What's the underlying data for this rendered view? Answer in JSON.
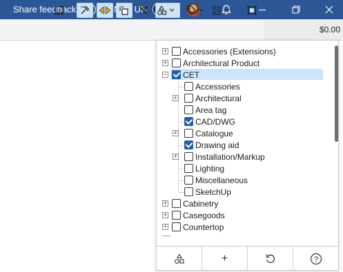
{
  "titlebar": {
    "share_feedback": "Share feedback",
    "new_ui_label": "New UI",
    "new_ui_enabled": true,
    "icons": [
      "help-icon",
      "avatar",
      "notification-icon",
      "minimize-icon",
      "restore-icon",
      "close-icon"
    ],
    "background": "#2b5797"
  },
  "toolbar": {
    "price": "$0.00",
    "tools": [
      "book-icon",
      "pin-tool-icon",
      "mirror-icon",
      "rotate-corner-icon",
      "measure-tool-icon",
      "shapes-filter-icon",
      "tag-icon",
      "list-icon",
      "crop-frame-icon"
    ]
  },
  "filter_panel": {
    "items": [
      {
        "label": "Accessories (Extensions)",
        "expandable": true,
        "checked": false,
        "level": 0
      },
      {
        "label": "Architectural Product",
        "expandable": true,
        "checked": false,
        "level": 0
      },
      {
        "label": "CET",
        "expandable": true,
        "expanded": true,
        "checked": true,
        "level": 0,
        "selected": true
      },
      {
        "label": "Accessories",
        "expandable": false,
        "checked": false,
        "level": 1
      },
      {
        "label": "Architectural",
        "expandable": true,
        "checked": false,
        "level": 1
      },
      {
        "label": "Area tag",
        "expandable": false,
        "checked": false,
        "level": 1
      },
      {
        "label": "CAD/DWG",
        "expandable": false,
        "checked": true,
        "level": 1
      },
      {
        "label": "Catalogue",
        "expandable": true,
        "checked": false,
        "level": 1
      },
      {
        "label": "Drawing aid",
        "expandable": false,
        "checked": true,
        "level": 1
      },
      {
        "label": "Installation/Markup",
        "expandable": true,
        "checked": false,
        "level": 1
      },
      {
        "label": "Lighting",
        "expandable": false,
        "checked": false,
        "level": 1
      },
      {
        "label": "Miscellaneous",
        "expandable": false,
        "checked": false,
        "level": 1
      },
      {
        "label": "SketchUp",
        "expandable": false,
        "checked": false,
        "level": 1
      },
      {
        "label": "Cabinetry",
        "expandable": true,
        "checked": false,
        "level": 0
      },
      {
        "label": "Casegoods",
        "expandable": true,
        "checked": false,
        "level": 0
      },
      {
        "label": "Countertop",
        "expandable": true,
        "checked": false,
        "level": 0
      }
    ],
    "bottom_buttons": [
      {
        "icon": "shapes-icon",
        "symbol": "⌂"
      },
      {
        "icon": "add-icon",
        "symbol": "+"
      },
      {
        "icon": "reset-icon",
        "symbol": "↺"
      },
      {
        "icon": "help-icon",
        "symbol": "?"
      }
    ],
    "selection_color": "#cde3f7",
    "check_color": "#1f5fa8"
  }
}
